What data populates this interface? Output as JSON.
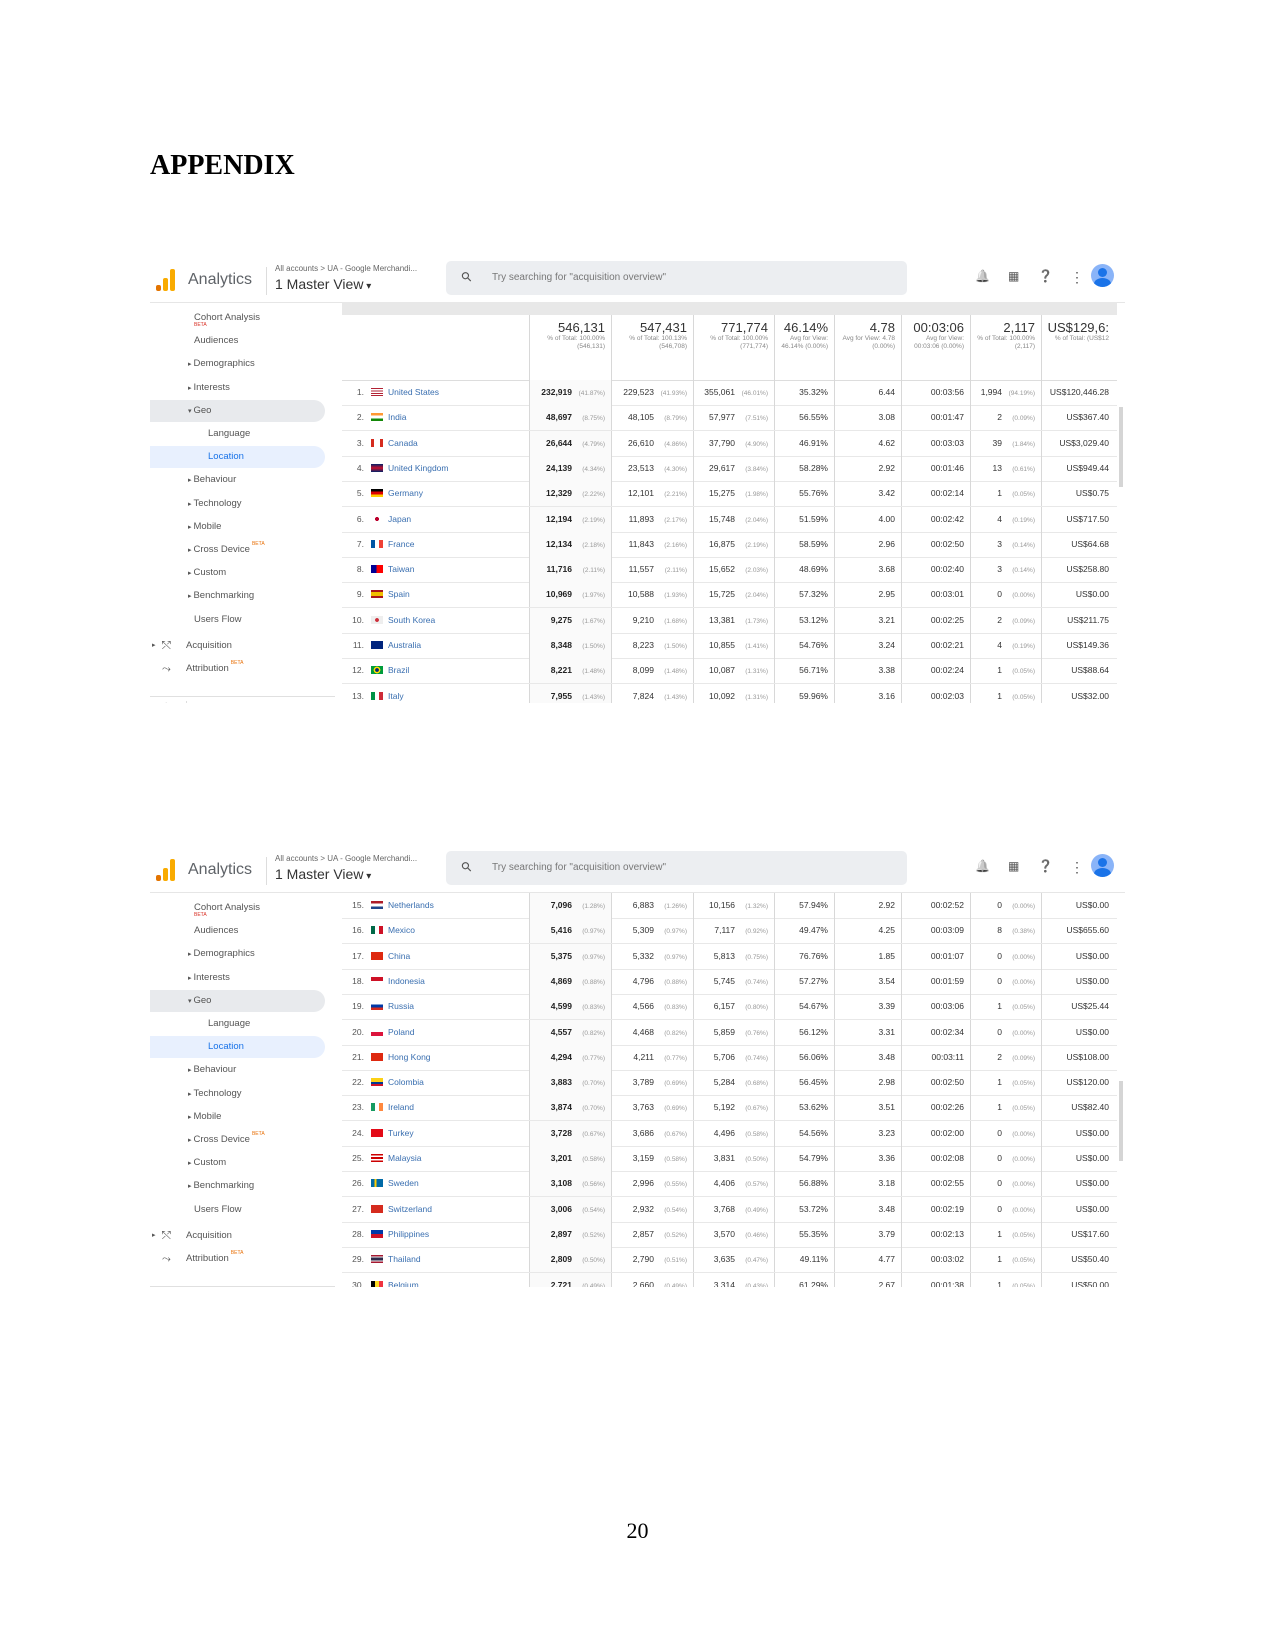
{
  "document": {
    "heading": "APPENDIX",
    "page_number": "20"
  },
  "app": {
    "name": "Analytics",
    "breadcrumb": "All accounts > UA - Google Merchandi...",
    "view": "1 Master View",
    "search_placeholder": "Try searching for \"acquisition overview\"",
    "icons": [
      "bell-icon",
      "apps-grid-icon",
      "help-icon",
      "more-vert-icon",
      "avatar-icon"
    ],
    "logo_colors": [
      "#f9ab00",
      "#e37400"
    ]
  },
  "sidebar": {
    "items": [
      {
        "label": "Cohort Analysis",
        "badge": "BETA"
      },
      {
        "label": "Audiences"
      },
      {
        "label": "Demographics",
        "expandable": true
      },
      {
        "label": "Interests",
        "expandable": true
      },
      {
        "label": "Geo",
        "expanded": true
      },
      {
        "label": "Language"
      },
      {
        "label": "Location",
        "selected": true
      },
      {
        "label": "Behaviour",
        "expandable": true
      },
      {
        "label": "Technology",
        "expandable": true
      },
      {
        "label": "Mobile",
        "expandable": true
      },
      {
        "label": "Cross Device",
        "expandable": true,
        "badge": "BETA"
      },
      {
        "label": "Custom",
        "expandable": true
      },
      {
        "label": "Benchmarking",
        "expandable": true
      },
      {
        "label": "Users Flow"
      },
      {
        "label": "Acquisition"
      },
      {
        "label": "Attribution",
        "badge": "BETA"
      }
    ]
  },
  "totals": [
    {
      "value": "546,131",
      "sub": "% of Total: 100.00% (546,131)"
    },
    {
      "value": "547,431",
      "sub": "% of Total: 100.13% (546,708)"
    },
    {
      "value": "771,774",
      "sub": "% of Total: 100.00% (771,774)"
    },
    {
      "value": "46.14%",
      "sub": "Avg for View: 46.14% (0.00%)"
    },
    {
      "value": "4.78",
      "sub": "Avg for View: 4.78 (0.00%)"
    },
    {
      "value": "00:03:06",
      "sub": "Avg for View: 00:03:06 (0.00%)"
    },
    {
      "value": "2,117",
      "sub": "% of Total: 100.00% (2,117)"
    },
    {
      "value": "US$129,6:",
      "sub": "% of Total: (US$12"
    }
  ],
  "table1": [
    {
      "n": "1.",
      "country": "United States",
      "users": "232,919",
      "users_pct": "(41.87%)",
      "new_users": "229,523",
      "new_pct": "(41.93%)",
      "sessions": "355,061",
      "sess_pct": "(46.01%)",
      "bounce": "35.32%",
      "pages": "6.44",
      "duration": "00:03:56",
      "trans": "1,994",
      "trans_pct": "(94.19%)",
      "revenue": "US$120,446.28"
    },
    {
      "n": "2.",
      "country": "India",
      "users": "48,697",
      "users_pct": "(8.75%)",
      "new_users": "48,105",
      "new_pct": "(8.79%)",
      "sessions": "57,977",
      "sess_pct": "(7.51%)",
      "bounce": "56.55%",
      "pages": "3.08",
      "duration": "00:01:47",
      "trans": "2",
      "trans_pct": "(0.09%)",
      "revenue": "US$367.40"
    },
    {
      "n": "3.",
      "country": "Canada",
      "users": "26,644",
      "users_pct": "(4.79%)",
      "new_users": "26,610",
      "new_pct": "(4.86%)",
      "sessions": "37,790",
      "sess_pct": "(4.90%)",
      "bounce": "46.91%",
      "pages": "4.62",
      "duration": "00:03:03",
      "trans": "39",
      "trans_pct": "(1.84%)",
      "revenue": "US$3,029.40"
    },
    {
      "n": "4.",
      "country": "United Kingdom",
      "users": "24,139",
      "users_pct": "(4.34%)",
      "new_users": "23,513",
      "new_pct": "(4.30%)",
      "sessions": "29,617",
      "sess_pct": "(3.84%)",
      "bounce": "58.28%",
      "pages": "2.92",
      "duration": "00:01:46",
      "trans": "13",
      "trans_pct": "(0.61%)",
      "revenue": "US$949.44"
    },
    {
      "n": "5.",
      "country": "Germany",
      "users": "12,329",
      "users_pct": "(2.22%)",
      "new_users": "12,101",
      "new_pct": "(2.21%)",
      "sessions": "15,275",
      "sess_pct": "(1.98%)",
      "bounce": "55.76%",
      "pages": "3.42",
      "duration": "00:02:14",
      "trans": "1",
      "trans_pct": "(0.05%)",
      "revenue": "US$0.75"
    },
    {
      "n": "6.",
      "country": "Japan",
      "users": "12,194",
      "users_pct": "(2.19%)",
      "new_users": "11,893",
      "new_pct": "(2.17%)",
      "sessions": "15,748",
      "sess_pct": "(2.04%)",
      "bounce": "51.59%",
      "pages": "4.00",
      "duration": "00:02:42",
      "trans": "4",
      "trans_pct": "(0.19%)",
      "revenue": "US$717.50"
    },
    {
      "n": "7.",
      "country": "France",
      "users": "12,134",
      "users_pct": "(2.18%)",
      "new_users": "11,843",
      "new_pct": "(2.16%)",
      "sessions": "16,875",
      "sess_pct": "(2.19%)",
      "bounce": "58.59%",
      "pages": "2.96",
      "duration": "00:02:50",
      "trans": "3",
      "trans_pct": "(0.14%)",
      "revenue": "US$64.68"
    },
    {
      "n": "8.",
      "country": "Taiwan",
      "users": "11,716",
      "users_pct": "(2.11%)",
      "new_users": "11,557",
      "new_pct": "(2.11%)",
      "sessions": "15,652",
      "sess_pct": "(2.03%)",
      "bounce": "48.69%",
      "pages": "3.68",
      "duration": "00:02:40",
      "trans": "3",
      "trans_pct": "(0.14%)",
      "revenue": "US$258.80"
    },
    {
      "n": "9.",
      "country": "Spain",
      "users": "10,969",
      "users_pct": "(1.97%)",
      "new_users": "10,588",
      "new_pct": "(1.93%)",
      "sessions": "15,725",
      "sess_pct": "(2.04%)",
      "bounce": "57.32%",
      "pages": "2.95",
      "duration": "00:03:01",
      "trans": "0",
      "trans_pct": "(0.00%)",
      "revenue": "US$0.00"
    },
    {
      "n": "10.",
      "country": "South Korea",
      "users": "9,275",
      "users_pct": "(1.67%)",
      "new_users": "9,210",
      "new_pct": "(1.68%)",
      "sessions": "13,381",
      "sess_pct": "(1.73%)",
      "bounce": "53.12%",
      "pages": "3.21",
      "duration": "00:02:25",
      "trans": "2",
      "trans_pct": "(0.09%)",
      "revenue": "US$211.75"
    },
    {
      "n": "11.",
      "country": "Australia",
      "users": "8,348",
      "users_pct": "(1.50%)",
      "new_users": "8,223",
      "new_pct": "(1.50%)",
      "sessions": "10,855",
      "sess_pct": "(1.41%)",
      "bounce": "54.76%",
      "pages": "3.24",
      "duration": "00:02:21",
      "trans": "4",
      "trans_pct": "(0.19%)",
      "revenue": "US$149.36"
    },
    {
      "n": "12.",
      "country": "Brazil",
      "users": "8,221",
      "users_pct": "(1.48%)",
      "new_users": "8,099",
      "new_pct": "(1.48%)",
      "sessions": "10,087",
      "sess_pct": "(1.31%)",
      "bounce": "56.71%",
      "pages": "3.38",
      "duration": "00:02:24",
      "trans": "1",
      "trans_pct": "(0.05%)",
      "revenue": "US$88.64"
    },
    {
      "n": "13.",
      "country": "Italy",
      "users": "7,955",
      "users_pct": "(1.43%)",
      "new_users": "7,824",
      "new_pct": "(1.43%)",
      "sessions": "10,092",
      "sess_pct": "(1.31%)",
      "bounce": "59.96%",
      "pages": "3.16",
      "duration": "00:02:03",
      "trans": "1",
      "trans_pct": "(0.05%)",
      "revenue": "US$32.00"
    }
  ],
  "table2": [
    {
      "n": "15.",
      "country": "Netherlands",
      "users": "7,096",
      "users_pct": "(1.28%)",
      "new_users": "6,883",
      "new_pct": "(1.26%)",
      "sessions": "10,156",
      "sess_pct": "(1.32%)",
      "bounce": "57.94%",
      "pages": "2.92",
      "duration": "00:02:52",
      "trans": "0",
      "trans_pct": "(0.00%)",
      "revenue": "US$0.00"
    },
    {
      "n": "16.",
      "country": "Mexico",
      "users": "5,416",
      "users_pct": "(0.97%)",
      "new_users": "5,309",
      "new_pct": "(0.97%)",
      "sessions": "7,117",
      "sess_pct": "(0.92%)",
      "bounce": "49.47%",
      "pages": "4.25",
      "duration": "00:03:09",
      "trans": "8",
      "trans_pct": "(0.38%)",
      "revenue": "US$655.60"
    },
    {
      "n": "17.",
      "country": "China",
      "users": "5,375",
      "users_pct": "(0.97%)",
      "new_users": "5,332",
      "new_pct": "(0.97%)",
      "sessions": "5,813",
      "sess_pct": "(0.75%)",
      "bounce": "76.76%",
      "pages": "1.85",
      "duration": "00:01:07",
      "trans": "0",
      "trans_pct": "(0.00%)",
      "revenue": "US$0.00"
    },
    {
      "n": "18.",
      "country": "Indonesia",
      "users": "4,869",
      "users_pct": "(0.88%)",
      "new_users": "4,796",
      "new_pct": "(0.88%)",
      "sessions": "5,745",
      "sess_pct": "(0.74%)",
      "bounce": "57.27%",
      "pages": "3.54",
      "duration": "00:01:59",
      "trans": "0",
      "trans_pct": "(0.00%)",
      "revenue": "US$0.00"
    },
    {
      "n": "19.",
      "country": "Russia",
      "users": "4,599",
      "users_pct": "(0.83%)",
      "new_users": "4,566",
      "new_pct": "(0.83%)",
      "sessions": "6,157",
      "sess_pct": "(0.80%)",
      "bounce": "54.67%",
      "pages": "3.39",
      "duration": "00:03:06",
      "trans": "1",
      "trans_pct": "(0.05%)",
      "revenue": "US$25.44"
    },
    {
      "n": "20.",
      "country": "Poland",
      "users": "4,557",
      "users_pct": "(0.82%)",
      "new_users": "4,468",
      "new_pct": "(0.82%)",
      "sessions": "5,859",
      "sess_pct": "(0.76%)",
      "bounce": "56.12%",
      "pages": "3.31",
      "duration": "00:02:34",
      "trans": "0",
      "trans_pct": "(0.00%)",
      "revenue": "US$0.00"
    },
    {
      "n": "21.",
      "country": "Hong Kong",
      "users": "4,294",
      "users_pct": "(0.77%)",
      "new_users": "4,211",
      "new_pct": "(0.77%)",
      "sessions": "5,706",
      "sess_pct": "(0.74%)",
      "bounce": "56.06%",
      "pages": "3.48",
      "duration": "00:03:11",
      "trans": "2",
      "trans_pct": "(0.09%)",
      "revenue": "US$108.00"
    },
    {
      "n": "22.",
      "country": "Colombia",
      "users": "3,883",
      "users_pct": "(0.70%)",
      "new_users": "3,789",
      "new_pct": "(0.69%)",
      "sessions": "5,284",
      "sess_pct": "(0.68%)",
      "bounce": "56.45%",
      "pages": "2.98",
      "duration": "00:02:50",
      "trans": "1",
      "trans_pct": "(0.05%)",
      "revenue": "US$120.00"
    },
    {
      "n": "23.",
      "country": "Ireland",
      "users": "3,874",
      "users_pct": "(0.70%)",
      "new_users": "3,763",
      "new_pct": "(0.69%)",
      "sessions": "5,192",
      "sess_pct": "(0.67%)",
      "bounce": "53.62%",
      "pages": "3.51",
      "duration": "00:02:26",
      "trans": "1",
      "trans_pct": "(0.05%)",
      "revenue": "US$82.40"
    },
    {
      "n": "24.",
      "country": "Turkey",
      "users": "3,728",
      "users_pct": "(0.67%)",
      "new_users": "3,686",
      "new_pct": "(0.67%)",
      "sessions": "4,496",
      "sess_pct": "(0.58%)",
      "bounce": "54.56%",
      "pages": "3.23",
      "duration": "00:02:00",
      "trans": "0",
      "trans_pct": "(0.00%)",
      "revenue": "US$0.00"
    },
    {
      "n": "25.",
      "country": "Malaysia",
      "users": "3,201",
      "users_pct": "(0.58%)",
      "new_users": "3,159",
      "new_pct": "(0.58%)",
      "sessions": "3,831",
      "sess_pct": "(0.50%)",
      "bounce": "54.79%",
      "pages": "3.36",
      "duration": "00:02:08",
      "trans": "0",
      "trans_pct": "(0.00%)",
      "revenue": "US$0.00"
    },
    {
      "n": "26.",
      "country": "Sweden",
      "users": "3,108",
      "users_pct": "(0.56%)",
      "new_users": "2,996",
      "new_pct": "(0.55%)",
      "sessions": "4,406",
      "sess_pct": "(0.57%)",
      "bounce": "56.88%",
      "pages": "3.18",
      "duration": "00:02:55",
      "trans": "0",
      "trans_pct": "(0.00%)",
      "revenue": "US$0.00"
    },
    {
      "n": "27.",
      "country": "Switzerland",
      "users": "3,006",
      "users_pct": "(0.54%)",
      "new_users": "2,932",
      "new_pct": "(0.54%)",
      "sessions": "3,768",
      "sess_pct": "(0.49%)",
      "bounce": "53.72%",
      "pages": "3.48",
      "duration": "00:02:19",
      "trans": "0",
      "trans_pct": "(0.00%)",
      "revenue": "US$0.00"
    },
    {
      "n": "28.",
      "country": "Philippines",
      "users": "2,897",
      "users_pct": "(0.52%)",
      "new_users": "2,857",
      "new_pct": "(0.52%)",
      "sessions": "3,570",
      "sess_pct": "(0.46%)",
      "bounce": "55.35%",
      "pages": "3.79",
      "duration": "00:02:13",
      "trans": "1",
      "trans_pct": "(0.05%)",
      "revenue": "US$17.60"
    },
    {
      "n": "29.",
      "country": "Thailand",
      "users": "2,809",
      "users_pct": "(0.50%)",
      "new_users": "2,790",
      "new_pct": "(0.51%)",
      "sessions": "3,635",
      "sess_pct": "(0.47%)",
      "bounce": "49.11%",
      "pages": "4.77",
      "duration": "00:03:02",
      "trans": "1",
      "trans_pct": "(0.05%)",
      "revenue": "US$50.40"
    },
    {
      "n": "30.",
      "country": "Belgium",
      "users": "2,721",
      "users_pct": "(0.49%)",
      "new_users": "2,660",
      "new_pct": "(0.49%)",
      "sessions": "3,314",
      "sess_pct": "(0.43%)",
      "bounce": "61.29%",
      "pages": "2.67",
      "duration": "00:01:38",
      "trans": "1",
      "trans_pct": "(0.05%)",
      "revenue": "US$50.00"
    }
  ]
}
